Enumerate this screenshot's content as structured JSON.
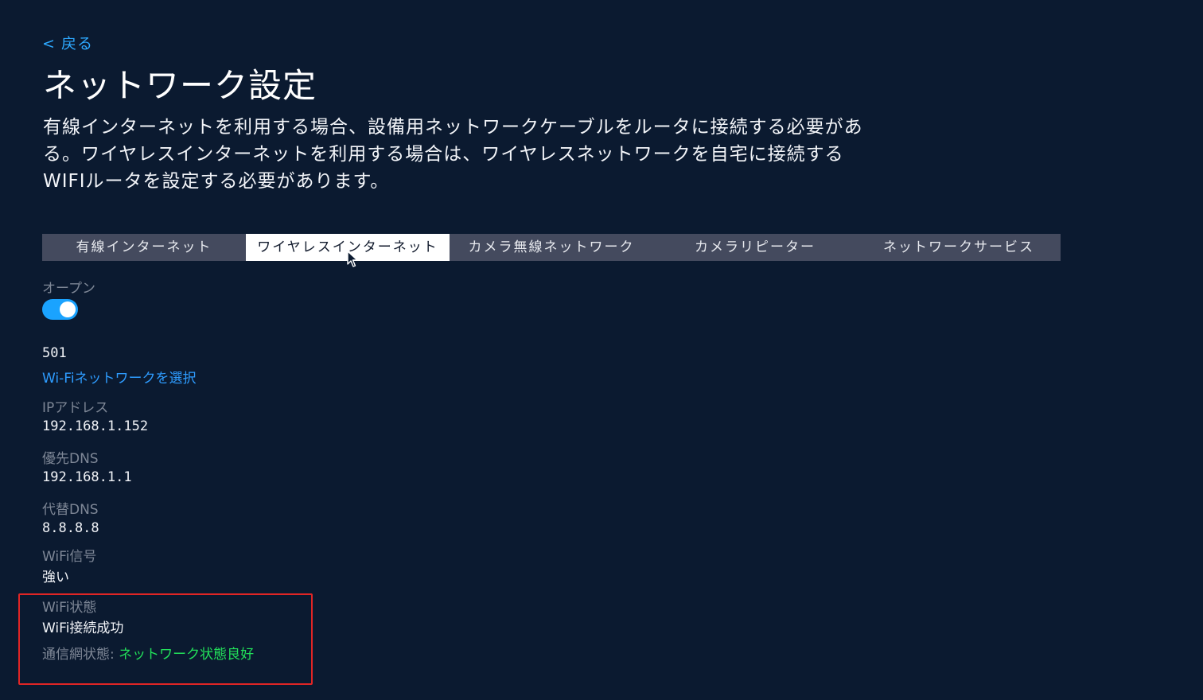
{
  "nav": {
    "back_label": "< 戻る"
  },
  "page": {
    "title": "ネットワーク設定",
    "description": "有線インターネットを利用する場合、設備用ネットワークケーブルをルータに接続する必要がある。ワイヤレスインターネットを利用する場合は、ワイヤレスネットワークを自宅に接続するWIFIルータを設定する必要があります。"
  },
  "tabs": [
    {
      "label": "有線インターネット",
      "active": false
    },
    {
      "label": "ワイヤレスインターネット",
      "active": true
    },
    {
      "label": "カメラ無線ネットワーク",
      "active": false
    },
    {
      "label": "カメラリピーター",
      "active": false
    },
    {
      "label": "ネットワークサービス",
      "active": false
    }
  ],
  "wireless": {
    "open_label": "オープン",
    "open_enabled": true,
    "ssid": "501",
    "select_network_label": "Wi-Fiネットワークを選択",
    "ip_label": "IPアドレス",
    "ip_value": "192.168.1.152",
    "dns_primary_label": "優先DNS",
    "dns_primary_value": "192.168.1.1",
    "dns_alt_label": "代替DNS",
    "dns_alt_value": "8.8.8.8",
    "signal_label": "WiFi信号",
    "signal_value": "強い",
    "wifi_state_label": "WiFi状態",
    "wifi_state_value": "WiFi接続成功",
    "net_state_label": "通信網状態:",
    "net_state_value": "ネットワーク状態良好"
  },
  "colors": {
    "background": "#0b1a30",
    "accent": "#1aa3ff",
    "link": "#2e9cff",
    "success": "#22e05a",
    "highlight_border": "#e02525"
  },
  "icons": {
    "cursor": "mouse-pointer-icon"
  }
}
